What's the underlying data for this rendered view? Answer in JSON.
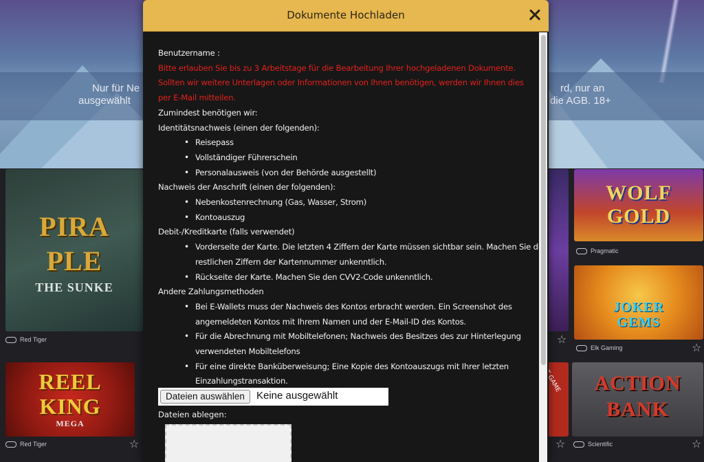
{
  "background": {
    "notice_left_line1": "Nur für Ne",
    "notice_left_line2": "ausgewählt",
    "notice_right_line1": "rd, nur an",
    "notice_right_line2": "die AGB. 18+",
    "tiles": {
      "pirate": {
        "title1": "PIRA",
        "title2": "PLE",
        "subtitle": "THE SUNKE",
        "provider": "Red Tiger"
      },
      "wolf": {
        "title1": "WOLF",
        "title2": "GOLD",
        "provider": "Pragmatic"
      },
      "joker": {
        "title1": "JOKER",
        "title2": "GEMS",
        "provider": "Elk Gaming"
      },
      "reel": {
        "title1": "REEL",
        "title2": "KING",
        "title3": "MEGA",
        "provider": "Red Tiger"
      },
      "action": {
        "title1": "ACTION",
        "title2": "BANK",
        "provider": "Scientific"
      },
      "partial_label": "T GAME"
    }
  },
  "modal": {
    "title": "Dokumente Hochladen",
    "username_label": "Benutzername :",
    "notice_lines": [
      "Bitte erlauben Sie bis zu 3 Arbeitstage für die Bearbeitung Ihrer hochgeladenen Dokumente.",
      "Sollten wir weitere Unterlagen oder Informationen von Ihnen benötigen, werden wir Ihnen dies",
      "per E-Mail mitteilen."
    ],
    "min_required": "Zumindest benötigen wir:",
    "identity_heading": "Identitätsnachweis (einen der folgenden):",
    "identity_items": [
      "Reisepass",
      "Vollständiger Führerschein",
      "Personalausweis (von der Behörde ausgestellt)"
    ],
    "address_heading": "Nachweis der Anschrift (einen der folgenden):",
    "address_items": [
      "Nebenkostenrechnung (Gas, Wasser, Strom)",
      "Kontoauszug"
    ],
    "card_heading": "Debit-/Kreditkarte (falls verwendet)",
    "card_items": [
      {
        "l1": "Vorderseite der Karte. Die letzten 4 Ziffern der Karte müssen sichtbar sein. Machen Sie die",
        "l2": "restlichen Ziffern der Kartennummer unkenntlich."
      },
      {
        "l1": "Rückseite der Karte. Machen Sie den CVV2-Code unkenntlich."
      }
    ],
    "other_heading": "Andere Zahlungsmethoden",
    "other_items": [
      {
        "l1": "Bei E-Wallets muss der Nachweis des Kontos erbracht werden. Ein Screenshot des",
        "l2": "angemeldeten Kontos mit Ihrem Namen und der E-Mail-ID des Kontos."
      },
      {
        "l1": "Für die Abrechnung mit Mobiltelefonen; Nachweis des Besitzes des zur Hinterlegung",
        "l2": "verwendeten Mobiltelefons"
      },
      {
        "l1": "Für eine direkte Banküberweisung; Eine Kopie des Kontoauszugs mit Ihrer letzten",
        "l2": "Einzahlungstransaktion."
      }
    ],
    "file_button": "Dateien auswählen",
    "file_status": "Keine ausgewählt",
    "drop_label": "Dateien ablegen:"
  },
  "colors": {
    "header": "#e7b750",
    "modal_bg": "#171717",
    "notice_red": "#e2211c"
  }
}
